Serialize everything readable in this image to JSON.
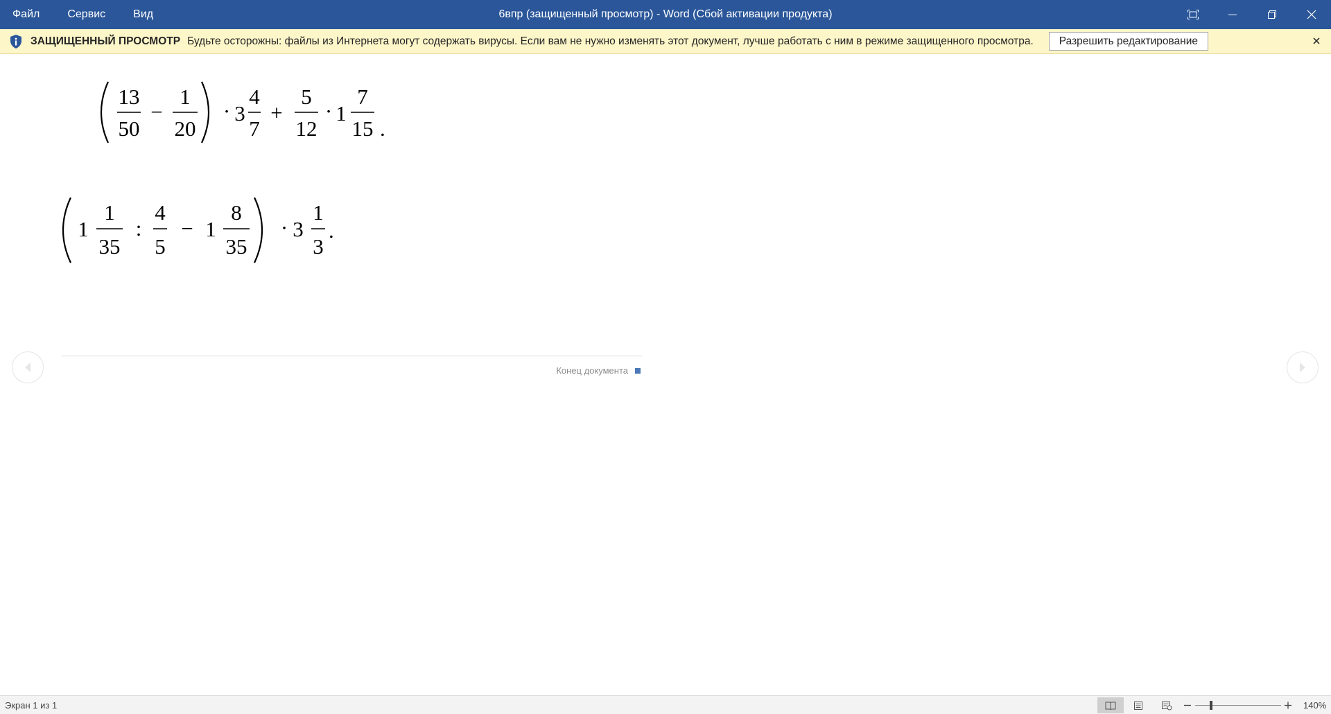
{
  "titlebar": {
    "menu": [
      "Файл",
      "Сервис",
      "Вид"
    ],
    "title": "6впр (защищенный просмотр) - Word (Сбой активации продукта)",
    "controls": [
      "fullscreen-icon",
      "minimize-icon",
      "restore-icon",
      "close-icon"
    ]
  },
  "protected_view": {
    "title": "ЗАЩИЩЕННЫЙ ПРОСМОТР",
    "message": "Будьте осторожны: файлы из Интернета могут содержать вирусы. Если вам не нужно изменять этот документ, лучше работать с ним в режиме защищенного просмотра.",
    "enable_button": "Разрешить редактирование"
  },
  "document": {
    "expression_1": {
      "fraction_a": [
        "13",
        "50"
      ],
      "minus": "−",
      "fraction_b": [
        "1",
        "20"
      ],
      "dot": "·",
      "mixed_1_whole": "3",
      "mixed_1_frac": [
        "4",
        "7"
      ],
      "plus": "+",
      "fraction_c": [
        "5",
        "12"
      ],
      "mixed_2_whole": "1",
      "mixed_2_frac": [
        "7",
        "15"
      ],
      "end": "."
    },
    "expression_2": {
      "mixed_1_whole": "1",
      "mixed_1_frac": [
        "1",
        "35"
      ],
      "colon": ":",
      "fraction_a": [
        "4",
        "5"
      ],
      "minus": "−",
      "mixed_2_whole": "1",
      "mixed_2_frac": [
        "8",
        "35"
      ],
      "dot": "·",
      "mixed_3_whole": "3",
      "mixed_3_frac": [
        "1",
        "3"
      ],
      "end": "."
    },
    "end_label": "Конец документа"
  },
  "statusbar": {
    "page": "Экран 1 из 1",
    "zoom": "140%"
  },
  "colors": {
    "titlebar": "#2b579a",
    "protected_bar": "#fdf6c9",
    "end_marker": "#4a78b8"
  }
}
